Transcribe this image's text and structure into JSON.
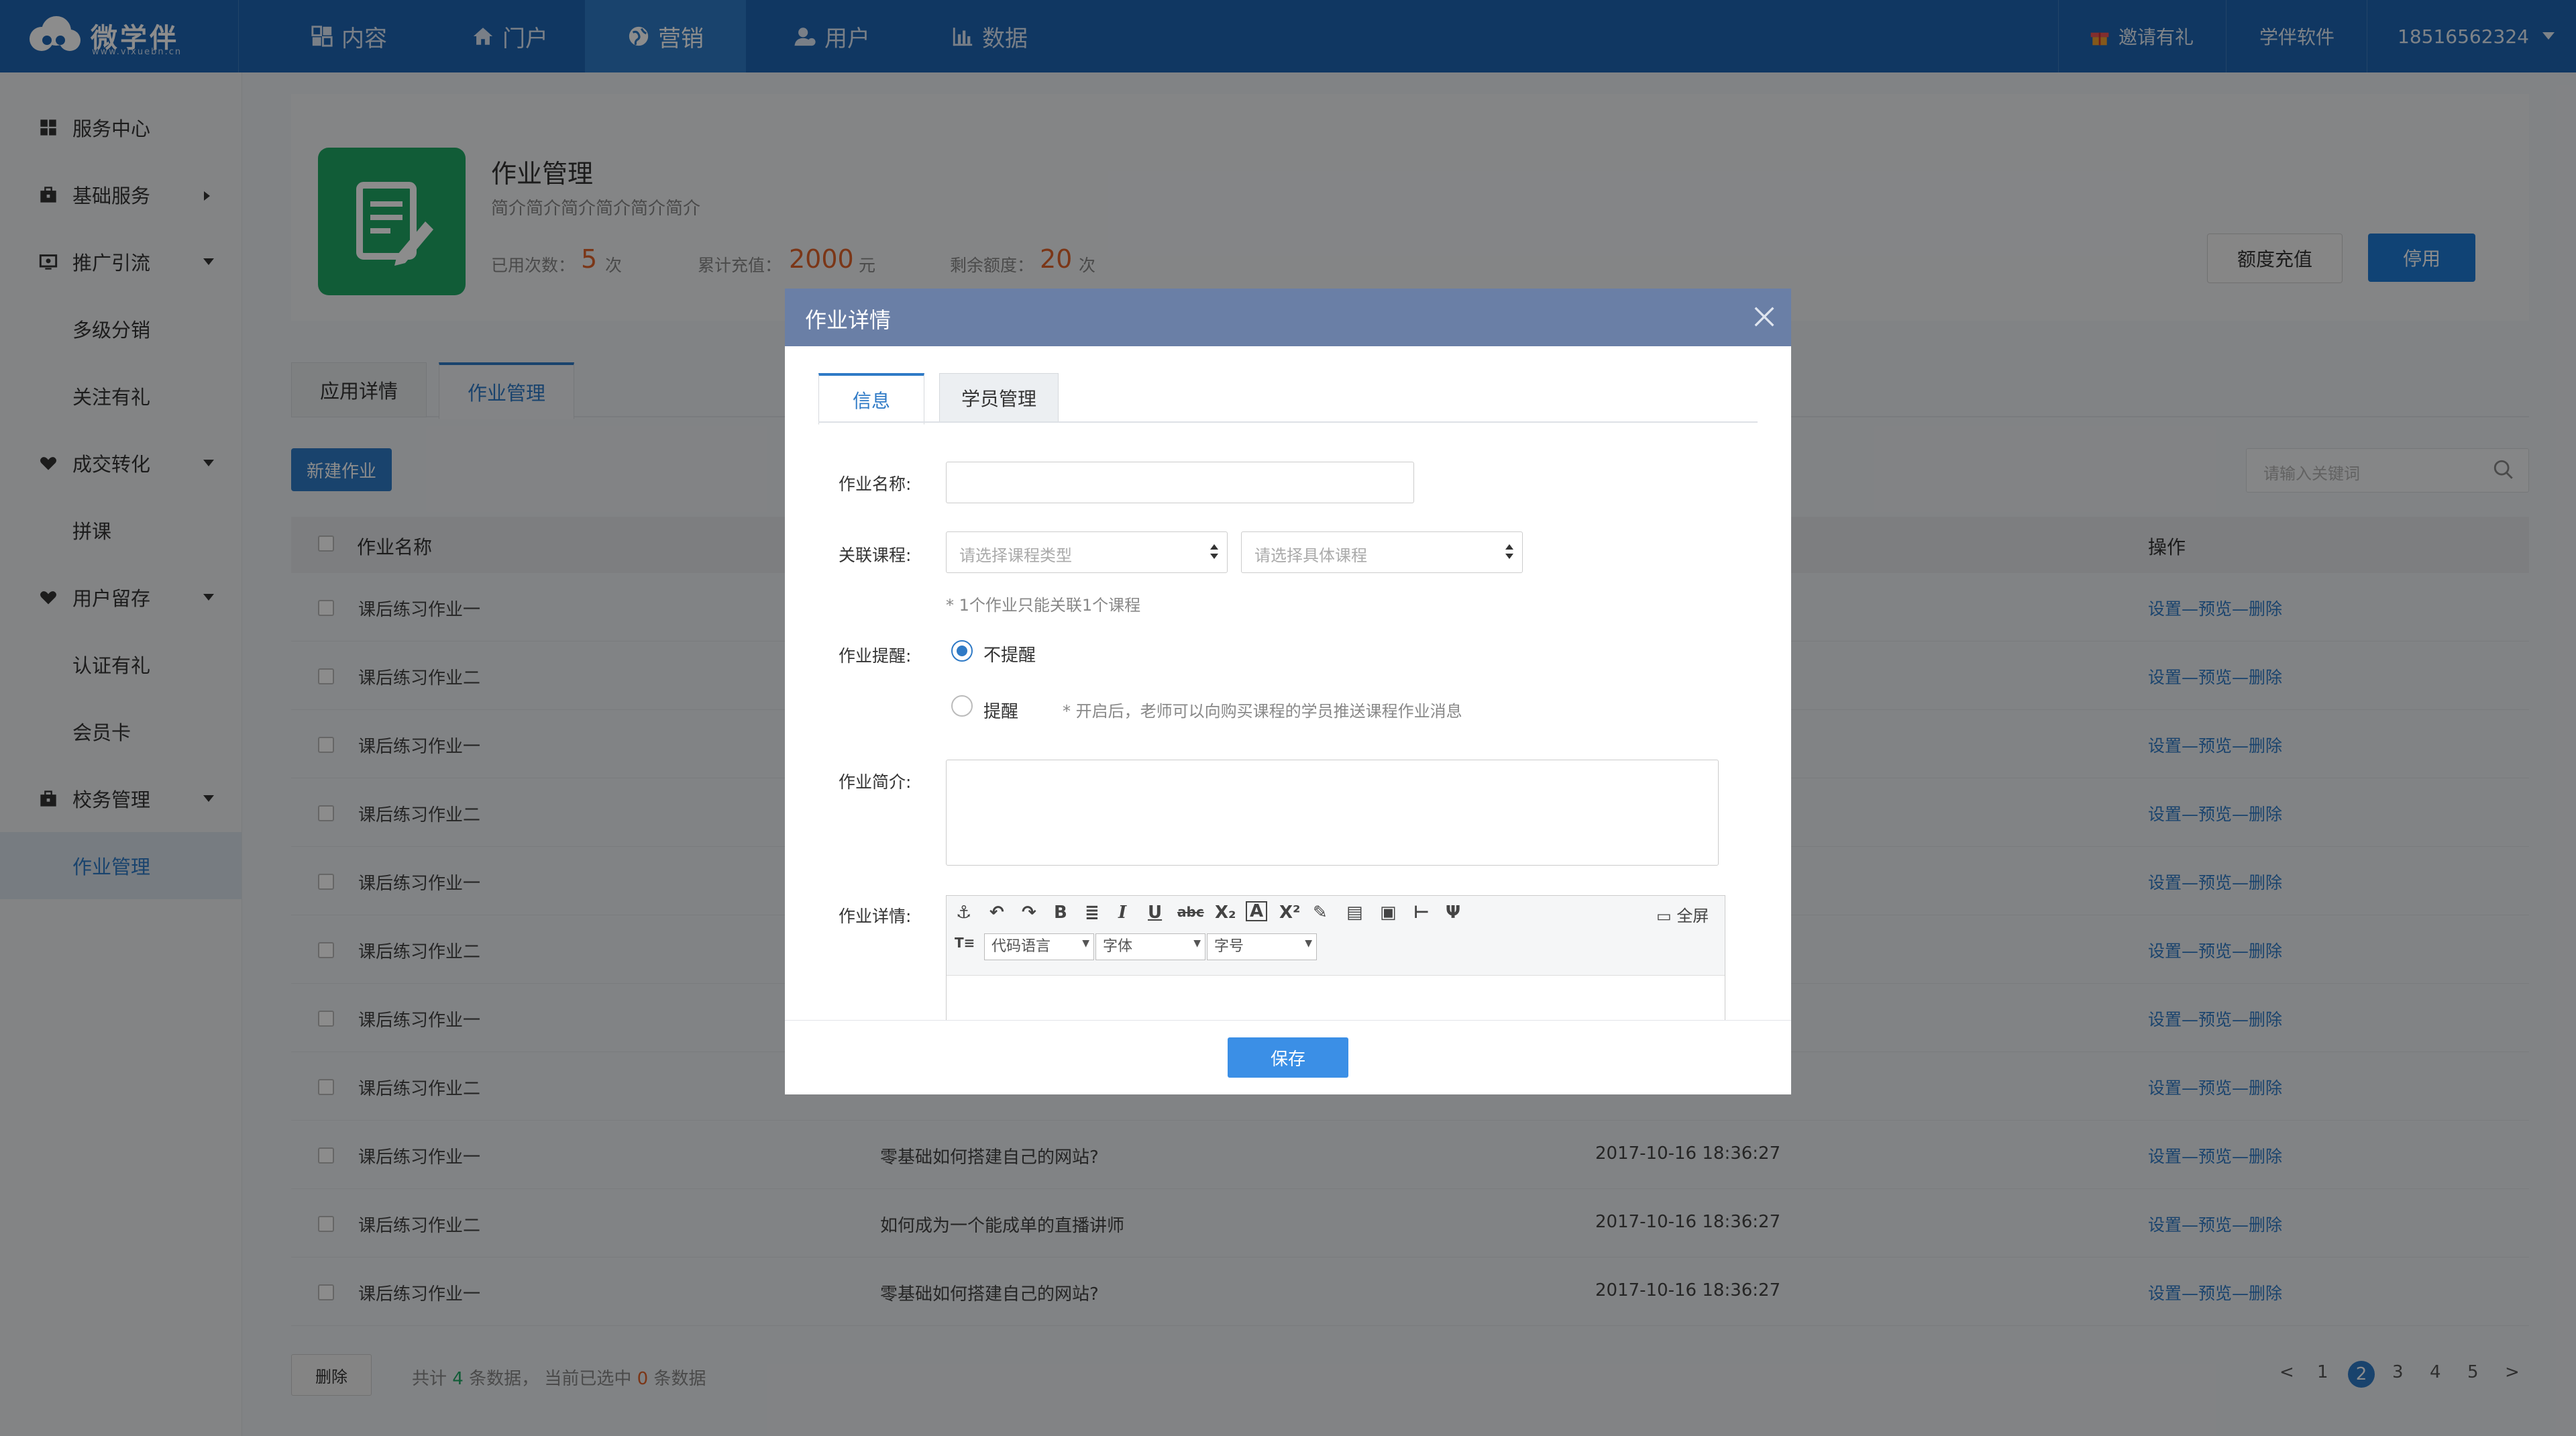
{
  "brand": {
    "name": "微学伴",
    "sub": "www.vixuebn.cn",
    "color": "#1e65b3"
  },
  "nav": [
    {
      "label": "内容",
      "icon": "grid-icon"
    },
    {
      "label": "门户",
      "icon": "home-icon"
    },
    {
      "label": "营销",
      "icon": "globe-icon"
    },
    {
      "label": "用户",
      "icon": "user-icon"
    },
    {
      "label": "数据",
      "icon": "bar-chart-icon"
    }
  ],
  "top_right": {
    "invite": "邀请有礼",
    "company": "学伴软件",
    "phone": "18516562324"
  },
  "sidebar": [
    {
      "label": "服务中心"
    },
    {
      "label": "基础服务"
    },
    {
      "label": "推广引流"
    },
    {
      "label": "多级分销"
    },
    {
      "label": "关注有礼"
    },
    {
      "label": "成交转化"
    },
    {
      "label": "拼课"
    },
    {
      "label": "用户留存"
    },
    {
      "label": "认证有礼"
    },
    {
      "label": "会员卡"
    },
    {
      "label": "校务管理"
    },
    {
      "label": "作业管理"
    }
  ],
  "app": {
    "title": "作业管理",
    "desc": "简介简介简介简介简介简介",
    "used_label": "已用次数：",
    "used_value": "5",
    "used_unit": "次",
    "total_label": "累计充值：",
    "total_value": "2000",
    "total_unit": "元",
    "remain_label": "剩余额度：",
    "remain_value": "20",
    "remain_unit": "次",
    "btn_recharge": "额度充值",
    "btn_stop": "停用"
  },
  "tabs": [
    "应用详情",
    "作业管理"
  ],
  "toolbar": {
    "new_btn": "新建作业",
    "search_ph": "请输入关键词"
  },
  "table": {
    "headers": {
      "name": "作业名称",
      "ops": "操作"
    },
    "rows": [
      {
        "name": "课后练习作业一",
        "course": "",
        "time": ""
      },
      {
        "name": "课后练习作业二",
        "course": "",
        "time": ""
      },
      {
        "name": "课后练习作业一",
        "course": "",
        "time": ""
      },
      {
        "name": "课后练习作业二",
        "course": "",
        "time": ""
      },
      {
        "name": "课后练习作业一",
        "course": "",
        "time": ""
      },
      {
        "name": "课后练习作业二",
        "course": "",
        "time": ""
      },
      {
        "name": "课后练习作业一",
        "course": "",
        "time": ""
      },
      {
        "name": "课后练习作业二",
        "course": "",
        "time": ""
      },
      {
        "name": "课后练习作业一",
        "course": "零基础如何搭建自己的网站?",
        "time": "2017-10-16 18:36:27"
      },
      {
        "name": "课后练习作业二",
        "course": "如何成为一个能成单的直播讲师",
        "time": "2017-10-16 18:36:27"
      },
      {
        "name": "课后练习作业一",
        "course": "零基础如何搭建自己的网站?",
        "time": "2017-10-16 18:36:27"
      }
    ],
    "ops": {
      "set": "设置",
      "preview": "预览",
      "delete": "删除",
      "sep": "—"
    }
  },
  "footer": {
    "del_btn": "删除",
    "summary_pre": "共计",
    "total": "4",
    "summary_mid": "条数据， 当前已选中",
    "selected": "0",
    "summary_post": "条数据",
    "pages": [
      "<",
      "1",
      "2",
      "3",
      "4",
      "5",
      ">"
    ],
    "current_page": "2"
  },
  "modal": {
    "title": "作业详情",
    "tabs": [
      "信息",
      "学员管理"
    ],
    "name_label": "作业名称:",
    "course_label": "关联课程:",
    "course_type_ph": "请选择课程类型",
    "course_ph": "请选择具体课程",
    "course_hint": "* 1个作业只能关联1个课程",
    "remind_label": "作业提醒:",
    "opt_no": "不提醒",
    "opt_yes": "提醒",
    "remind_hint": "* 开启后，老师可以向购买课程的学员推送课程作业消息",
    "intro_label": "作业简介:",
    "detail_label": "作业详情:",
    "editor": {
      "fullscreen": "全屏",
      "code_lang": "代码语言",
      "font": "字体",
      "size": "字号"
    },
    "save": "保存"
  },
  "colors": {
    "accent": "#2f7ac6",
    "green": "#20a865",
    "orange": "#e0632a",
    "modal_header": "#6a7fa6"
  }
}
